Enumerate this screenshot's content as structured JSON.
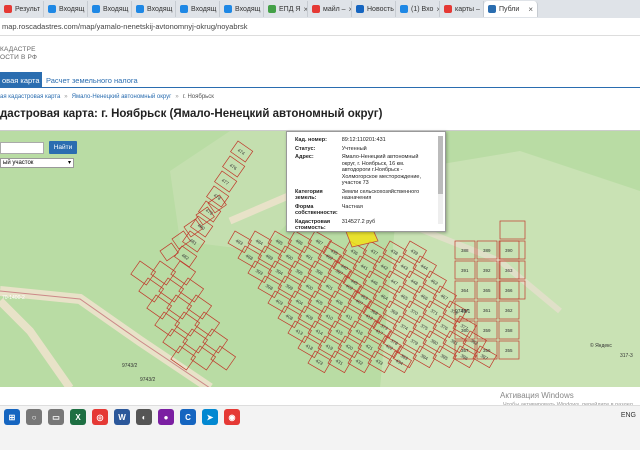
{
  "browser": {
    "tabs": [
      {
        "label": "Результ",
        "color": "#e53935"
      },
      {
        "label": "Входящ",
        "color": "#1e88e5"
      },
      {
        "label": "Входящ",
        "color": "#1e88e5"
      },
      {
        "label": "Входящ",
        "color": "#1e88e5"
      },
      {
        "label": "Входящ",
        "color": "#1e88e5"
      },
      {
        "label": "Входящ",
        "color": "#1e88e5"
      },
      {
        "label": "ЕПД Я",
        "color": "#43a047"
      },
      {
        "label": "майл –",
        "color": "#e53935"
      },
      {
        "label": "Новость",
        "color": "#1565c0"
      },
      {
        "label": "(1) Вхо",
        "color": "#1e88e5"
      },
      {
        "label": "карты –",
        "color": "#e53935"
      },
      {
        "label": "Публи",
        "color": "#2a6db0",
        "active": true
      }
    ],
    "tab_close_icon": "×",
    "url": "map.roscadastres.com/map/yamalo-nenetskij-avtonomnyj-okrug/noyabrsk"
  },
  "header": {
    "logo_line1": "КАДАСТРЕ",
    "logo_line2": "ОСТИ В РФ"
  },
  "nav": {
    "map_tab": "овая карта",
    "calc_link": "Расчет земельного налога"
  },
  "breadcrumbs": {
    "item1": "ая кадастровая карта",
    "item2": "Ямало-Ненецкий автономный округ",
    "item3": "г. Ноябрьск",
    "sep": "»"
  },
  "page": {
    "title": "дастровая карта: г. Ноябрьск (Ямало-Ненецкий автономный округ)"
  },
  "map": {
    "search_button": "Найти",
    "layer_select": "ый участок",
    "attribution": "© Яндекс"
  },
  "popup": {
    "rows": [
      {
        "key": "Кад. номер:",
        "value": "89:12:110201:431"
      },
      {
        "key": "Статус:",
        "value": "Учтенный"
      },
      {
        "key": "Адрес:",
        "value": "Ямало-Ненецкий автономный округ, г. Ноябрьск, 16 км. автодороги г.Ноябрьск - Холмогорское месторождение, участок 73"
      },
      {
        "key": "Категория земель:",
        "value": "Земли сельскохозяйственного назначения"
      },
      {
        "key": "Форма собственности:",
        "value": "Частная"
      },
      {
        "key": "Кадастровая стоимость:",
        "value": "314527.2 руб"
      },
      {
        "key": "Уточненная площадь:",
        "value": "863 кв м"
      }
    ]
  },
  "parcels": [
    "474",
    "476",
    "477",
    "478",
    "479",
    "480",
    "481",
    "482",
    "483",
    "484",
    "485",
    "486",
    "487",
    "488",
    "489",
    "490",
    "491",
    "492",
    "393",
    "394",
    "395",
    "396",
    "397",
    "398",
    "399",
    "400",
    "401",
    "402",
    "403",
    "404",
    "405",
    "406",
    "407",
    "408",
    "409",
    "410",
    "411",
    "412",
    "413",
    "414",
    "415",
    "416",
    "417",
    "418",
    "419",
    "420",
    "421",
    "422",
    "423",
    "431",
    "432",
    "433",
    "434",
    "435",
    "436",
    "437",
    "438",
    "439",
    "440",
    "441",
    "442",
    "443",
    "444",
    "445",
    "446",
    "447",
    "448",
    "462",
    "463",
    "464",
    "465",
    "466",
    "467",
    "368",
    "369",
    "370",
    "371",
    "372",
    "373",
    "374",
    "375",
    "376",
    "377",
    "378",
    "379",
    "380",
    "381",
    "382",
    "383",
    "384",
    "385",
    "386",
    "387",
    "388",
    "389",
    "390",
    "391",
    "392",
    "363",
    "364",
    "365",
    "366",
    "367",
    "361",
    "362",
    "360",
    "359",
    "358",
    "357",
    "356",
    "355"
  ],
  "road_labels": {
    "label1": "70-1400-2",
    "label2": "9743/2",
    "label3": "9743/1",
    "label4": "9743/2",
    "label5": "317-3"
  },
  "os": {
    "activation_title": "Активация Windows",
    "activation_sub": "Чтобы активировать Windows, перейдите в раздел",
    "taskbar_icons": [
      {
        "name": "windows",
        "color": "#1565c0",
        "glyph": "⊞"
      },
      {
        "name": "search",
        "color": "#777",
        "glyph": "○"
      },
      {
        "name": "taskview",
        "color": "#777",
        "glyph": "▭"
      },
      {
        "name": "excel",
        "color": "#1d6f42",
        "glyph": "X"
      },
      {
        "name": "chrome-yandex",
        "color": "#e53935",
        "glyph": "◎"
      },
      {
        "name": "word",
        "color": "#2b579a",
        "glyph": "W"
      },
      {
        "name": "app1",
        "color": "#555",
        "glyph": "◐"
      },
      {
        "name": "app2",
        "color": "#7b1fa2",
        "glyph": "●"
      },
      {
        "name": "app3",
        "color": "#1565c0",
        "glyph": "C"
      },
      {
        "name": "app4",
        "color": "#0288d1",
        "glyph": "➤"
      },
      {
        "name": "app5",
        "color": "#e53935",
        "glyph": "◉"
      }
    ],
    "tray_text": "ENG"
  }
}
